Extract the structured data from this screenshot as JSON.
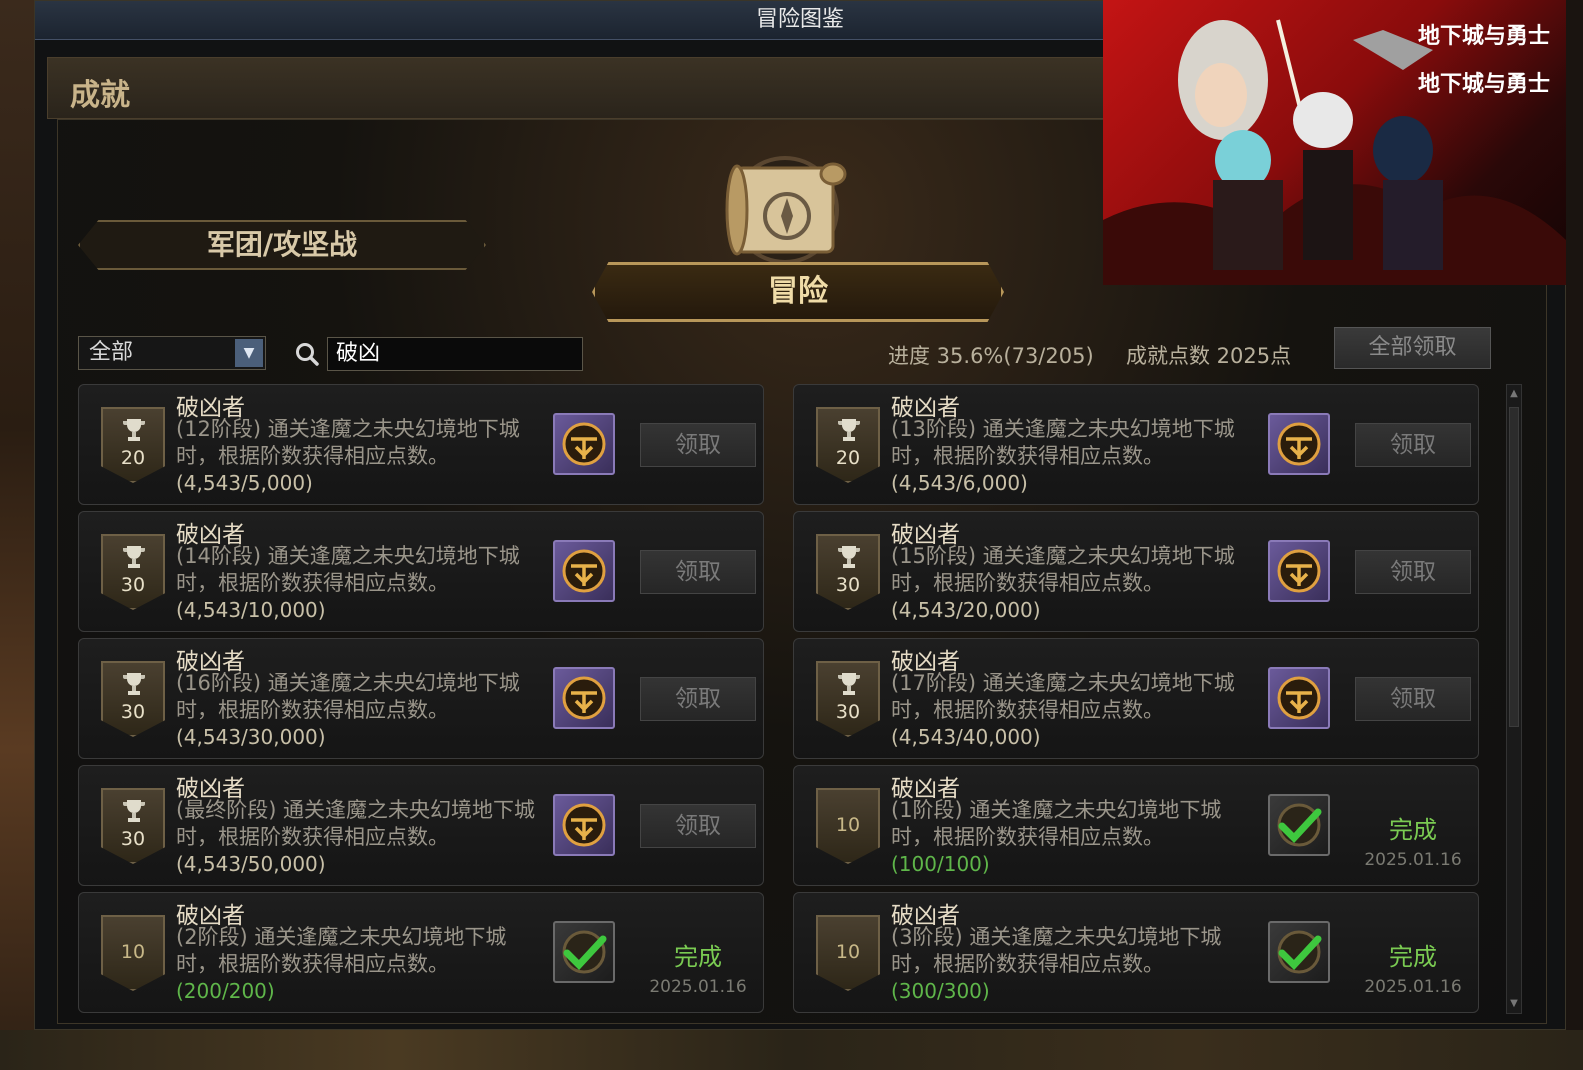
{
  "window": {
    "title": "冒险图鉴"
  },
  "section": {
    "title": "成就"
  },
  "tabs": {
    "guild": "军团/攻坚战",
    "adventure": "冒险"
  },
  "filter": {
    "selected": "全部"
  },
  "search": {
    "value": "破凶"
  },
  "stats": {
    "progress": "进度 35.6%(73/205)",
    "points": "成就点数 2025点"
  },
  "claim_all": "全部领取",
  "promo": {
    "logo_top": "地下城与勇士",
    "logo_bottom": "地下城与勇士"
  },
  "achievements": [
    {
      "title": "破凶者",
      "desc": "(12阶段) 通关逢魔之未央幻境地下城时，根据阶数获得相应点数。",
      "count": "(4,543/5,000)",
      "points": "20",
      "status": "claim",
      "action": "领取",
      "date": ""
    },
    {
      "title": "破凶者",
      "desc": "(13阶段) 通关逢魔之未央幻境地下城时，根据阶数获得相应点数。",
      "count": "(4,543/6,000)",
      "points": "20",
      "status": "claim",
      "action": "领取",
      "date": ""
    },
    {
      "title": "破凶者",
      "desc": "(14阶段) 通关逢魔之未央幻境地下城时，根据阶数获得相应点数。",
      "count": "(4,543/10,000)",
      "points": "30",
      "status": "claim",
      "action": "领取",
      "date": ""
    },
    {
      "title": "破凶者",
      "desc": "(15阶段) 通关逢魔之未央幻境地下城时，根据阶数获得相应点数。",
      "count": "(4,543/20,000)",
      "points": "30",
      "status": "claim",
      "action": "领取",
      "date": ""
    },
    {
      "title": "破凶者",
      "desc": "(16阶段) 通关逢魔之未央幻境地下城时，根据阶数获得相应点数。",
      "count": "(4,543/30,000)",
      "points": "30",
      "status": "claim",
      "action": "领取",
      "date": ""
    },
    {
      "title": "破凶者",
      "desc": "(17阶段) 通关逢魔之未央幻境地下城时，根据阶数获得相应点数。",
      "count": "(4,543/40,000)",
      "points": "30",
      "status": "claim",
      "action": "领取",
      "date": ""
    },
    {
      "title": "破凶者",
      "desc": "(最终阶段) 通关逢魔之未央幻境地下城时，根据阶数获得相应点数。",
      "count": "(4,543/50,000)",
      "points": "30",
      "status": "claim",
      "action": "领取",
      "date": ""
    },
    {
      "title": "破凶者",
      "desc": "(1阶段) 通关逢魔之未央幻境地下城时，根据阶数获得相应点数。",
      "count": "(100/100)",
      "points": "10",
      "status": "done",
      "action": "完成",
      "date": "2025.01.16"
    },
    {
      "title": "破凶者",
      "desc": "(2阶段) 通关逢魔之未央幻境地下城时，根据阶数获得相应点数。",
      "count": "(200/200)",
      "points": "10",
      "status": "done",
      "action": "完成",
      "date": "2025.01.16"
    },
    {
      "title": "破凶者",
      "desc": "(3阶段) 通关逢魔之未央幻境地下城时，根据阶数获得相应点数。",
      "count": "(300/300)",
      "points": "10",
      "status": "done",
      "action": "完成",
      "date": "2025.01.16"
    }
  ]
}
